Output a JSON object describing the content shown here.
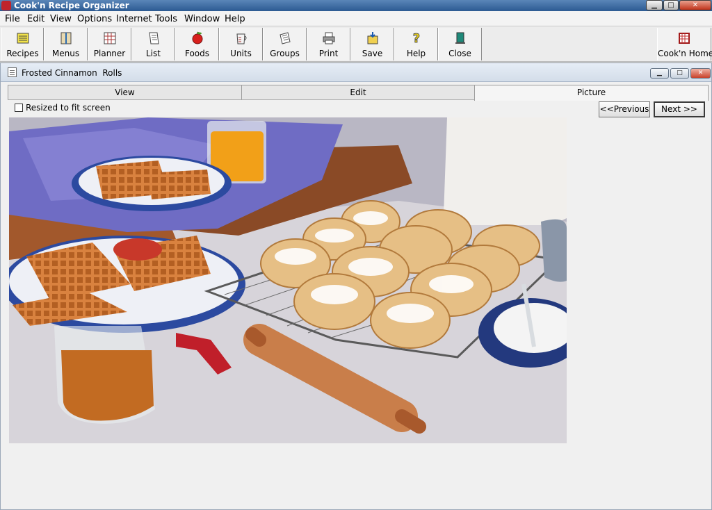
{
  "window": {
    "title": "Cook'n Recipe Organizer",
    "min": "▁",
    "max": "□",
    "close": "✕"
  },
  "menu": [
    "File",
    "Edit",
    "View",
    "Options",
    "Internet",
    "Tools",
    "Window",
    "Help"
  ],
  "toolbar": [
    {
      "label": "Recipes",
      "icon": "recipes-icon"
    },
    {
      "label": "Menus",
      "icon": "menus-icon"
    },
    {
      "label": "Planner",
      "icon": "planner-icon"
    },
    {
      "label": "List",
      "icon": "list-icon"
    },
    {
      "label": "Foods",
      "icon": "apple-icon"
    },
    {
      "label": "Units",
      "icon": "measuring-cup-icon"
    },
    {
      "label": "Groups",
      "icon": "groups-icon"
    },
    {
      "label": "Print",
      "icon": "printer-icon"
    },
    {
      "label": "Save",
      "icon": "save-icon"
    },
    {
      "label": "Help",
      "icon": "help-icon"
    },
    {
      "label": "Close",
      "icon": "door-icon"
    },
    {
      "label": "Cook'n Home",
      "icon": "home-icon"
    }
  ],
  "document": {
    "title": "Frosted Cinnamon  Rolls",
    "tabs": [
      {
        "label": "View",
        "active": false
      },
      {
        "label": "Edit",
        "active": false
      },
      {
        "label": "Picture",
        "active": true
      }
    ],
    "resize_label": "Resized to fit screen",
    "resize_checked": false,
    "prev_label": "<<Previous",
    "next_label": "Next >>"
  },
  "colors": {
    "title_bar": "#2c5a92",
    "close_button": "#c0341c"
  }
}
